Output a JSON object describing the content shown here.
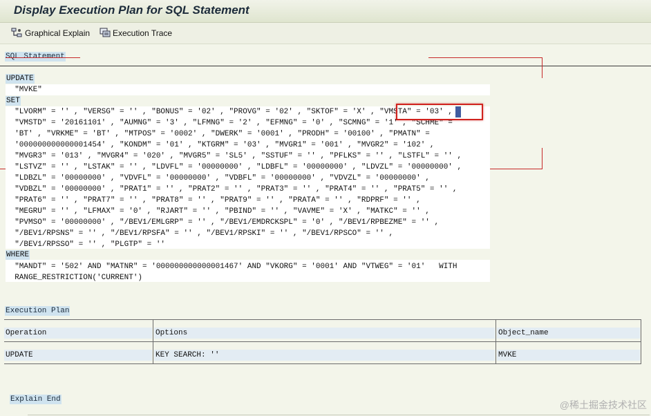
{
  "window": {
    "title": "Display Execution Plan for SQL Statement"
  },
  "toolbar": {
    "graphical_explain": "Graphical Explain",
    "execution_trace": "Execution Trace"
  },
  "sql": {
    "heading": "SQL Statement",
    "keyword_update": "UPDATE",
    "table_line": "  \"MVKE\"",
    "keyword_set": "SET",
    "set_lines": [
      "  \"LVORM\" = '' , \"VERSG\" = '' , \"BONUS\" = '02' , \"PROVG\" = '02' , \"SKTOF\" = 'X' , \"VMSTA\" = '03' ,",
      "  \"VMSTD\" = '20161101' , \"AUMNG\" = '3' , \"LFMNG\" = '2' , \"EFMNG\" = '0' , \"SCMNG\" = '1' , \"SCHME\" =",
      "  'BT' , \"VRKME\" = 'BT' , \"MTPOS\" = '0002' , \"DWERK\" = '0001' , \"PRODH\" = '00100' , \"PMATN\" =",
      "  '000000000000001454' , \"KONDM\" = '01' , \"KTGRM\" = '03' , \"MVGR1\" = '001' , \"MVGR2\" = '102' ,",
      "  \"MVGR3\" = '013' , \"MVGR4\" = '020' , \"MVGR5\" = 'SL5' , \"SSTUF\" = '' , \"PFLKS\" = '' , \"LSTFL\" = '' ,",
      "  \"LSTVZ\" = '' , \"LSTAK\" = '' , \"LDVFL\" = '00000000' , \"LDBFL\" = '00000000' , \"LDVZL\" = '00000000' ,",
      "  \"LDBZL\" = '00000000' , \"VDVFL\" = '00000000' , \"VDBFL\" = '00000000' , \"VDVZL\" = '00000000' ,",
      "  \"VDBZL\" = '00000000' , \"PRAT1\" = '' , \"PRAT2\" = '' , \"PRAT3\" = '' , \"PRAT4\" = '' , \"PRAT5\" = '' ,",
      "  \"PRAT6\" = '' , \"PRAT7\" = '' , \"PRAT8\" = '' , \"PRAT9\" = '' , \"PRATA\" = '' , \"RDPRF\" = '' ,",
      "  \"MEGRU\" = '' , \"LFMAX\" = '0' , \"RJART\" = '' , \"PBIND\" = '' , \"VAVME\" = 'X' , \"MATKC\" = '' ,",
      "  \"PVMSO\" = '00000000' , \"/BEV1/EMLGRP\" = '' , \"/BEV1/EMDRCKSPL\" = '0' , \"/BEV1/RPBEZME\" = '' ,",
      "  \"/BEV1/RPSNS\" = '' , \"/BEV1/RPSFA\" = '' , \"/BEV1/RPSKI\" = '' , \"/BEV1/RPSCO\" = '' ,",
      "  \"/BEV1/RPSSO\" = '' , \"PLGTP\" = ''"
    ],
    "keyword_where": "WHERE",
    "where_lines": [
      "  \"MANDT\" = '502' AND \"MATNR\" = '000000000000001467' AND \"VKORG\" = '0001' AND \"VTWEG\" = '01'   WITH",
      "  RANGE_RESTRICTION('CURRENT')"
    ]
  },
  "plan": {
    "heading": "Execution Plan",
    "columns": [
      "Operation",
      "Options",
      "Object_name"
    ],
    "rows": [
      [
        "UPDATE",
        "KEY SEARCH: ''",
        "MVKE"
      ]
    ]
  },
  "footer": {
    "explain_end": "Explain End"
  },
  "watermark": "@稀土掘金技术社区",
  "colors": {
    "highlight_bg": "#cfe3ef",
    "annotation_red": "#c62828",
    "selection_bg": "#1f3f8f"
  }
}
